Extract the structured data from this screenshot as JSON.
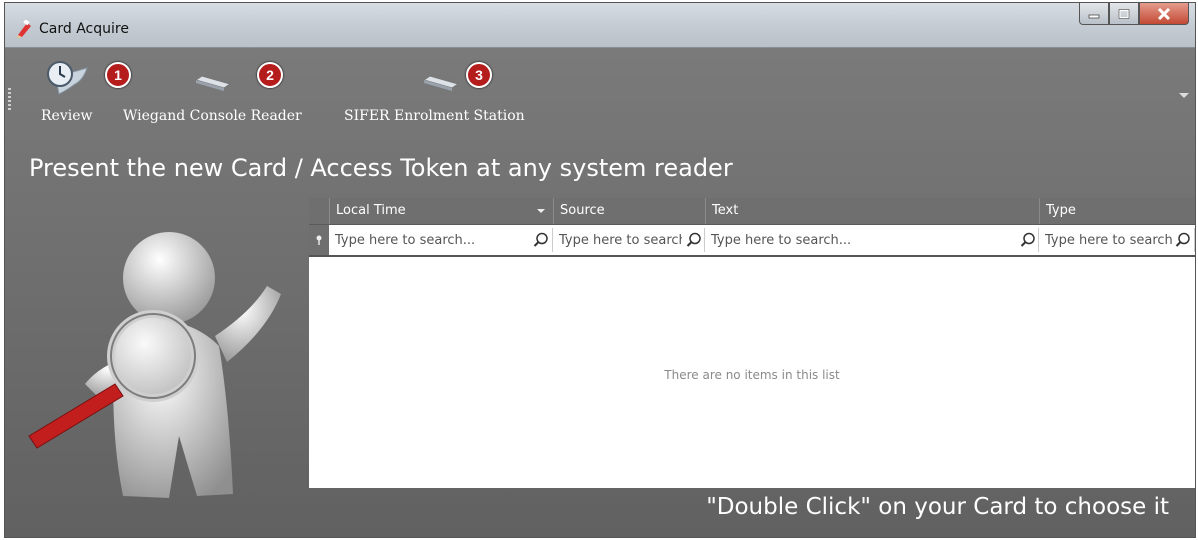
{
  "window": {
    "title": "Card Acquire",
    "icon": "card-pencil-icon"
  },
  "toolbar": {
    "items": [
      {
        "label": "Review",
        "icon": "review-clock-scroll-icon",
        "badge": "1"
      },
      {
        "label": "Wiegand Console Reader",
        "icon": "card-reader-icon",
        "badge": "2"
      },
      {
        "label": "SIFER Enrolment Station",
        "icon": "card-reader-icon",
        "badge": "3"
      }
    ]
  },
  "heading": "Present the new Card / Access Token at any system reader",
  "grid": {
    "columns": [
      "Local Time",
      "Source",
      "Text",
      "Type"
    ],
    "sorted_column": "Local Time",
    "filter_placeholder": "Type here to search...",
    "empty_text": "There are no items in this list"
  },
  "hint": "\"Double Click\" on your Card to choose it",
  "colors": {
    "badge": "#b51c1c",
    "background": "#6b6b6b"
  }
}
